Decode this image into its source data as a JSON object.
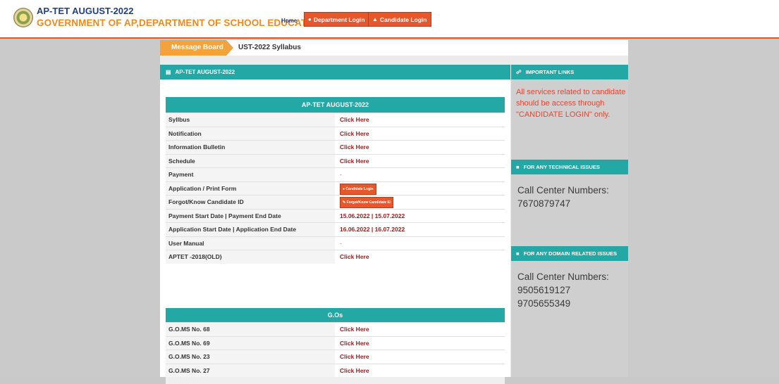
{
  "header": {
    "title": "AP-TET AUGUST-2022",
    "subtitle": "GOVERNMENT OF AP,DEPARTMENT OF SCHOOL EDUCATION.",
    "nav": {
      "home": "Home",
      "department_login": "Department Login",
      "candidate_login": "Candidate Login"
    }
  },
  "message_board": {
    "label": "Message Board",
    "text": "UST-2022 Syllabus"
  },
  "left_panel": {
    "heading": "AP-TET AUGUST-2022",
    "table_title": "AP-TET AUGUST-2022",
    "rows": [
      {
        "label": "Syllbus",
        "value": "Click Here"
      },
      {
        "label": "Notification",
        "value": "Click Here"
      },
      {
        "label": "Information Bulletin",
        "value": "Click Here"
      },
      {
        "label": "Schedule",
        "value": "Click Here"
      },
      {
        "label": "Payment",
        "value": "-"
      },
      {
        "label": "Application / Print Form",
        "value": "Candidate Login"
      },
      {
        "label": "Forgot/Know Candidate ID",
        "value": "Forgot/Know Candidate ID"
      },
      {
        "label": "Payment Start Date | Payment End Date",
        "value": "15.06.2022 | 15.07.2022"
      },
      {
        "label": "Application Start Date | Application End Date",
        "value": "16.06.2022 | 16.07.2022"
      },
      {
        "label": "User Manual",
        "value": "-"
      },
      {
        "label": "APTET -2018(OLD)",
        "value": "Click Here"
      }
    ],
    "gos_title": "G.Os",
    "gos": [
      {
        "label": "G.O.MS No. 68",
        "value": "Click Here"
      },
      {
        "label": "G.O.MS No. 69",
        "value": "Click Here"
      },
      {
        "label": "G.O.MS No. 23",
        "value": "Click Here"
      },
      {
        "label": "G.O.MS No. 27",
        "value": "Click Here"
      }
    ]
  },
  "right_panel": {
    "important_links_heading": "IMPORTANT LINKS",
    "important_note": "All services related to candidate should be access through \"CANDIDATE LOGIN\" only.",
    "technical_heading": "FOR ANY TECHNICAL ISSUES",
    "technical_label": "Call Center Numbers:",
    "technical_numbers": [
      "7670879747"
    ],
    "domain_heading": "FOR ANY DOMAIN RELATED ISSUES",
    "domain_label": "Call Center Numbers:",
    "domain_numbers": [
      "9505619127",
      "9705655349"
    ]
  },
  "colors": {
    "accent_orange": "#e8572a",
    "teal": "#23a8a6",
    "title_blue": "#1e3f84",
    "subtitle_orange": "#f08a1c",
    "link_red": "#9b1a1a"
  }
}
